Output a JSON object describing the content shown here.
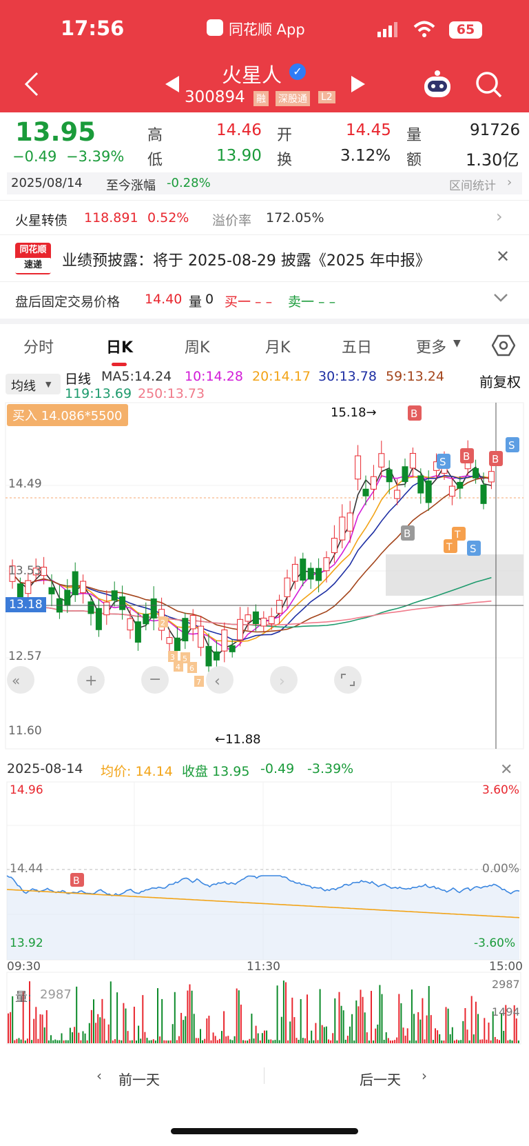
{
  "status_bar": {
    "time": "17:56",
    "app_label": "同花顺 App",
    "battery": "65"
  },
  "header": {
    "stock_name": "火星人",
    "stock_code": "300894",
    "tags": [
      "融",
      "深股通",
      "L2"
    ]
  },
  "quote": {
    "price": "13.95",
    "change": "−0.49",
    "change_pct": "−3.39%",
    "high_label": "高",
    "high": "14.46",
    "low_label": "低",
    "low": "13.90",
    "open_label": "开",
    "open": "14.45",
    "turnover_label": "换",
    "turnover": "3.12%",
    "volume_label": "量",
    "volume": "91726",
    "amount_label": "额",
    "amount": "1.30亿"
  },
  "range_stats": {
    "date": "2025/08/14",
    "label": "至今涨幅",
    "value": "-0.28%",
    "link": "区间统计"
  },
  "convertible_bond": {
    "name": "火星转债",
    "price": "118.891",
    "change": "0.52%",
    "premium_label": "溢价率",
    "premium": "172.05%"
  },
  "notice": {
    "logo_top": "同花顺",
    "logo_bottom": "速递",
    "text": "业绩预披露：将于 2025-08-29 披露《2025 年中报》"
  },
  "after_hours": {
    "label": "盘后固定交易价格",
    "price": "14.40",
    "vol_label": "量",
    "vol": "0",
    "buy1": "买一 – –",
    "sell1": "卖一 – –"
  },
  "tabs": [
    "分时",
    "日K",
    "周K",
    "月K",
    "五日",
    "更多"
  ],
  "kline": {
    "ma_select": "均线",
    "period": "日线",
    "ma_labels": [
      "MA5:14.24",
      "10:14.28",
      "20:14.17",
      "30:13.78",
      "59:13.24",
      "119:13.69",
      "250:13.73"
    ],
    "ma_colors": [
      "#333333",
      "#d21cd8",
      "#f2a316",
      "#1d2ea3",
      "#a3441a",
      "#1d9a6c",
      "#f07a8a"
    ],
    "adjust": "前复权",
    "buy_badge": "买入 14.086*5500",
    "price_levels": [
      "14.49",
      "13.53",
      "13.18",
      "12.57",
      "11.60"
    ],
    "high_mark": "15.18→",
    "low_mark": "←11.88"
  },
  "intraday": {
    "date": "2025-08-14",
    "avg_label": "均价: 14.14",
    "close_label": "收盘 13.95",
    "change": "-0.49",
    "change_pct": "-3.39%",
    "top_price": "14.96",
    "mid_price": "14.44",
    "bottom_price": "13.92",
    "top_pct": "3.60%",
    "mid_pct": "0.00%",
    "bottom_pct": "-3.60%",
    "times": [
      "09:30",
      "11:30",
      "15:00"
    ],
    "vol_label": "量:",
    "vol_value": "2987",
    "vol_max": "2987",
    "vol_mid": "1494"
  },
  "nav": {
    "prev": "前一天",
    "next": "后一天"
  }
}
